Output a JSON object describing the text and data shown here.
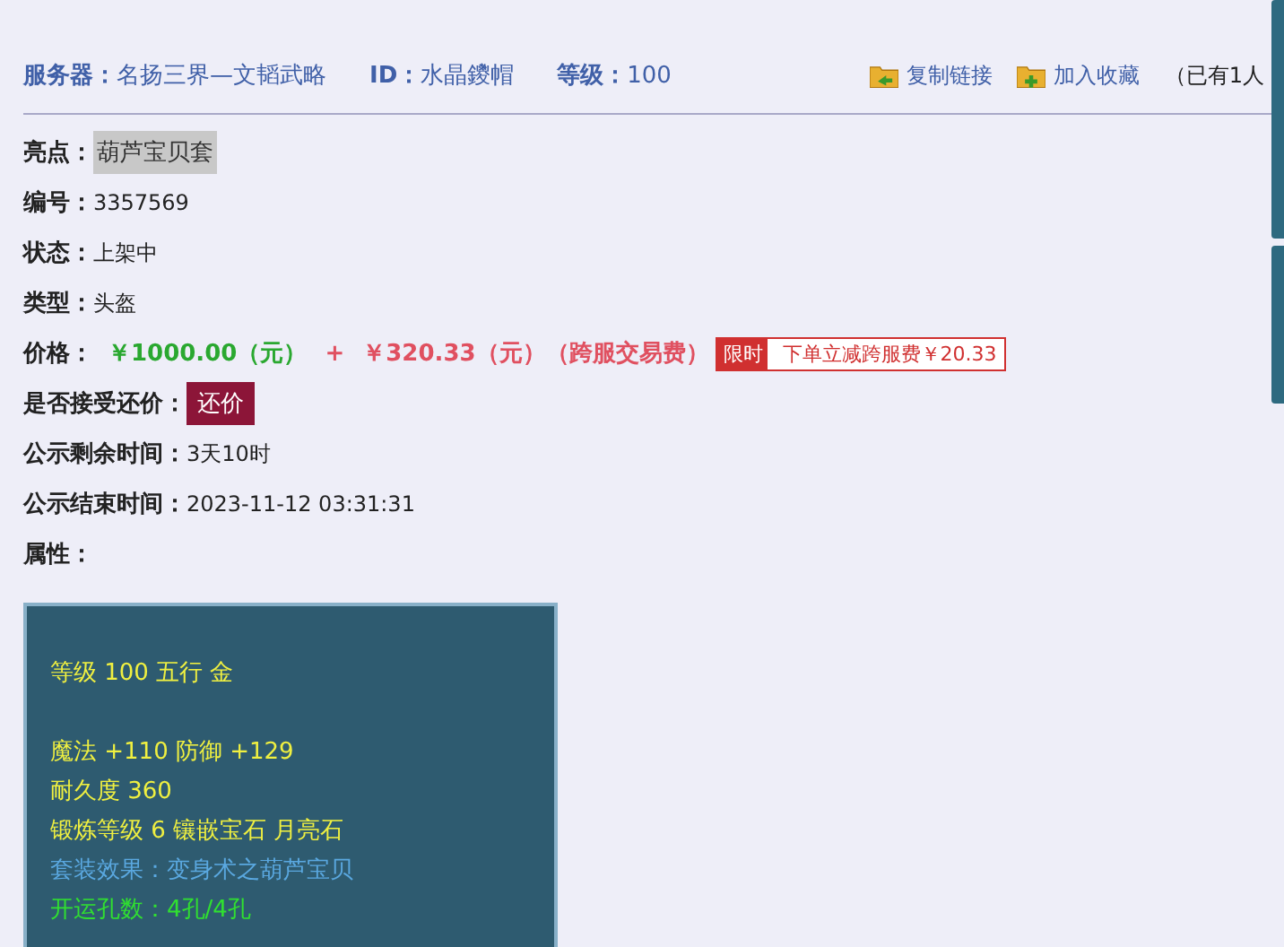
{
  "header": {
    "fields": [
      {
        "label": "服务器：",
        "value": "名扬三界—文韬武略"
      },
      {
        "label": "ID：",
        "value": "水晶鑁帽"
      },
      {
        "label": "等级：",
        "value": "100"
      }
    ],
    "links": [
      {
        "label": "复制链接",
        "kind": "copy"
      },
      {
        "label": "加入收藏",
        "kind": "favorite"
      }
    ],
    "note": "（已有1人"
  },
  "fields": [
    {
      "kind": "highlight",
      "label": "亮点：",
      "value": "葫芦宝贝套"
    },
    {
      "kind": "text",
      "label": "编号：",
      "value": "3357569"
    },
    {
      "kind": "text",
      "label": "状态：",
      "value": "上架中"
    },
    {
      "kind": "text",
      "label": "类型：",
      "value": "头盔"
    },
    {
      "kind": "price",
      "label": "价格：",
      "price": "￥1000.00（元）",
      "plus": "+",
      "fee": "￥320.33（元）（跨服交易费）",
      "tag": "限时",
      "promo": "下单立减跨服费￥20.33"
    },
    {
      "kind": "button",
      "label": "是否接受还价：",
      "value": "还价"
    },
    {
      "kind": "text",
      "label": "公示剩余时间：",
      "value": "3天10时"
    },
    {
      "kind": "text",
      "label": "公示结束时间：",
      "value": "2023-11-12 03:31:31"
    },
    {
      "kind": "text",
      "label": "属性："
    }
  ],
  "attribute_groups": [
    [
      {
        "text": "等级 100 五行 金",
        "color": "#f0f040"
      }
    ],
    [
      {
        "text": "魔法 +110 防御 +129",
        "color": "#f0f040"
      },
      {
        "text": "耐久度 360",
        "color": "#f0f040"
      },
      {
        "text": "锻炼等级 6 镶嵌宝石 月亮石",
        "color": "#f0f040"
      },
      {
        "text": "套装效果：变身术之葫芦宝贝",
        "color": "#5aa8e0"
      },
      {
        "text": "开运孔数：4孔/4孔",
        "color": "#30e030"
      }
    ]
  ]
}
